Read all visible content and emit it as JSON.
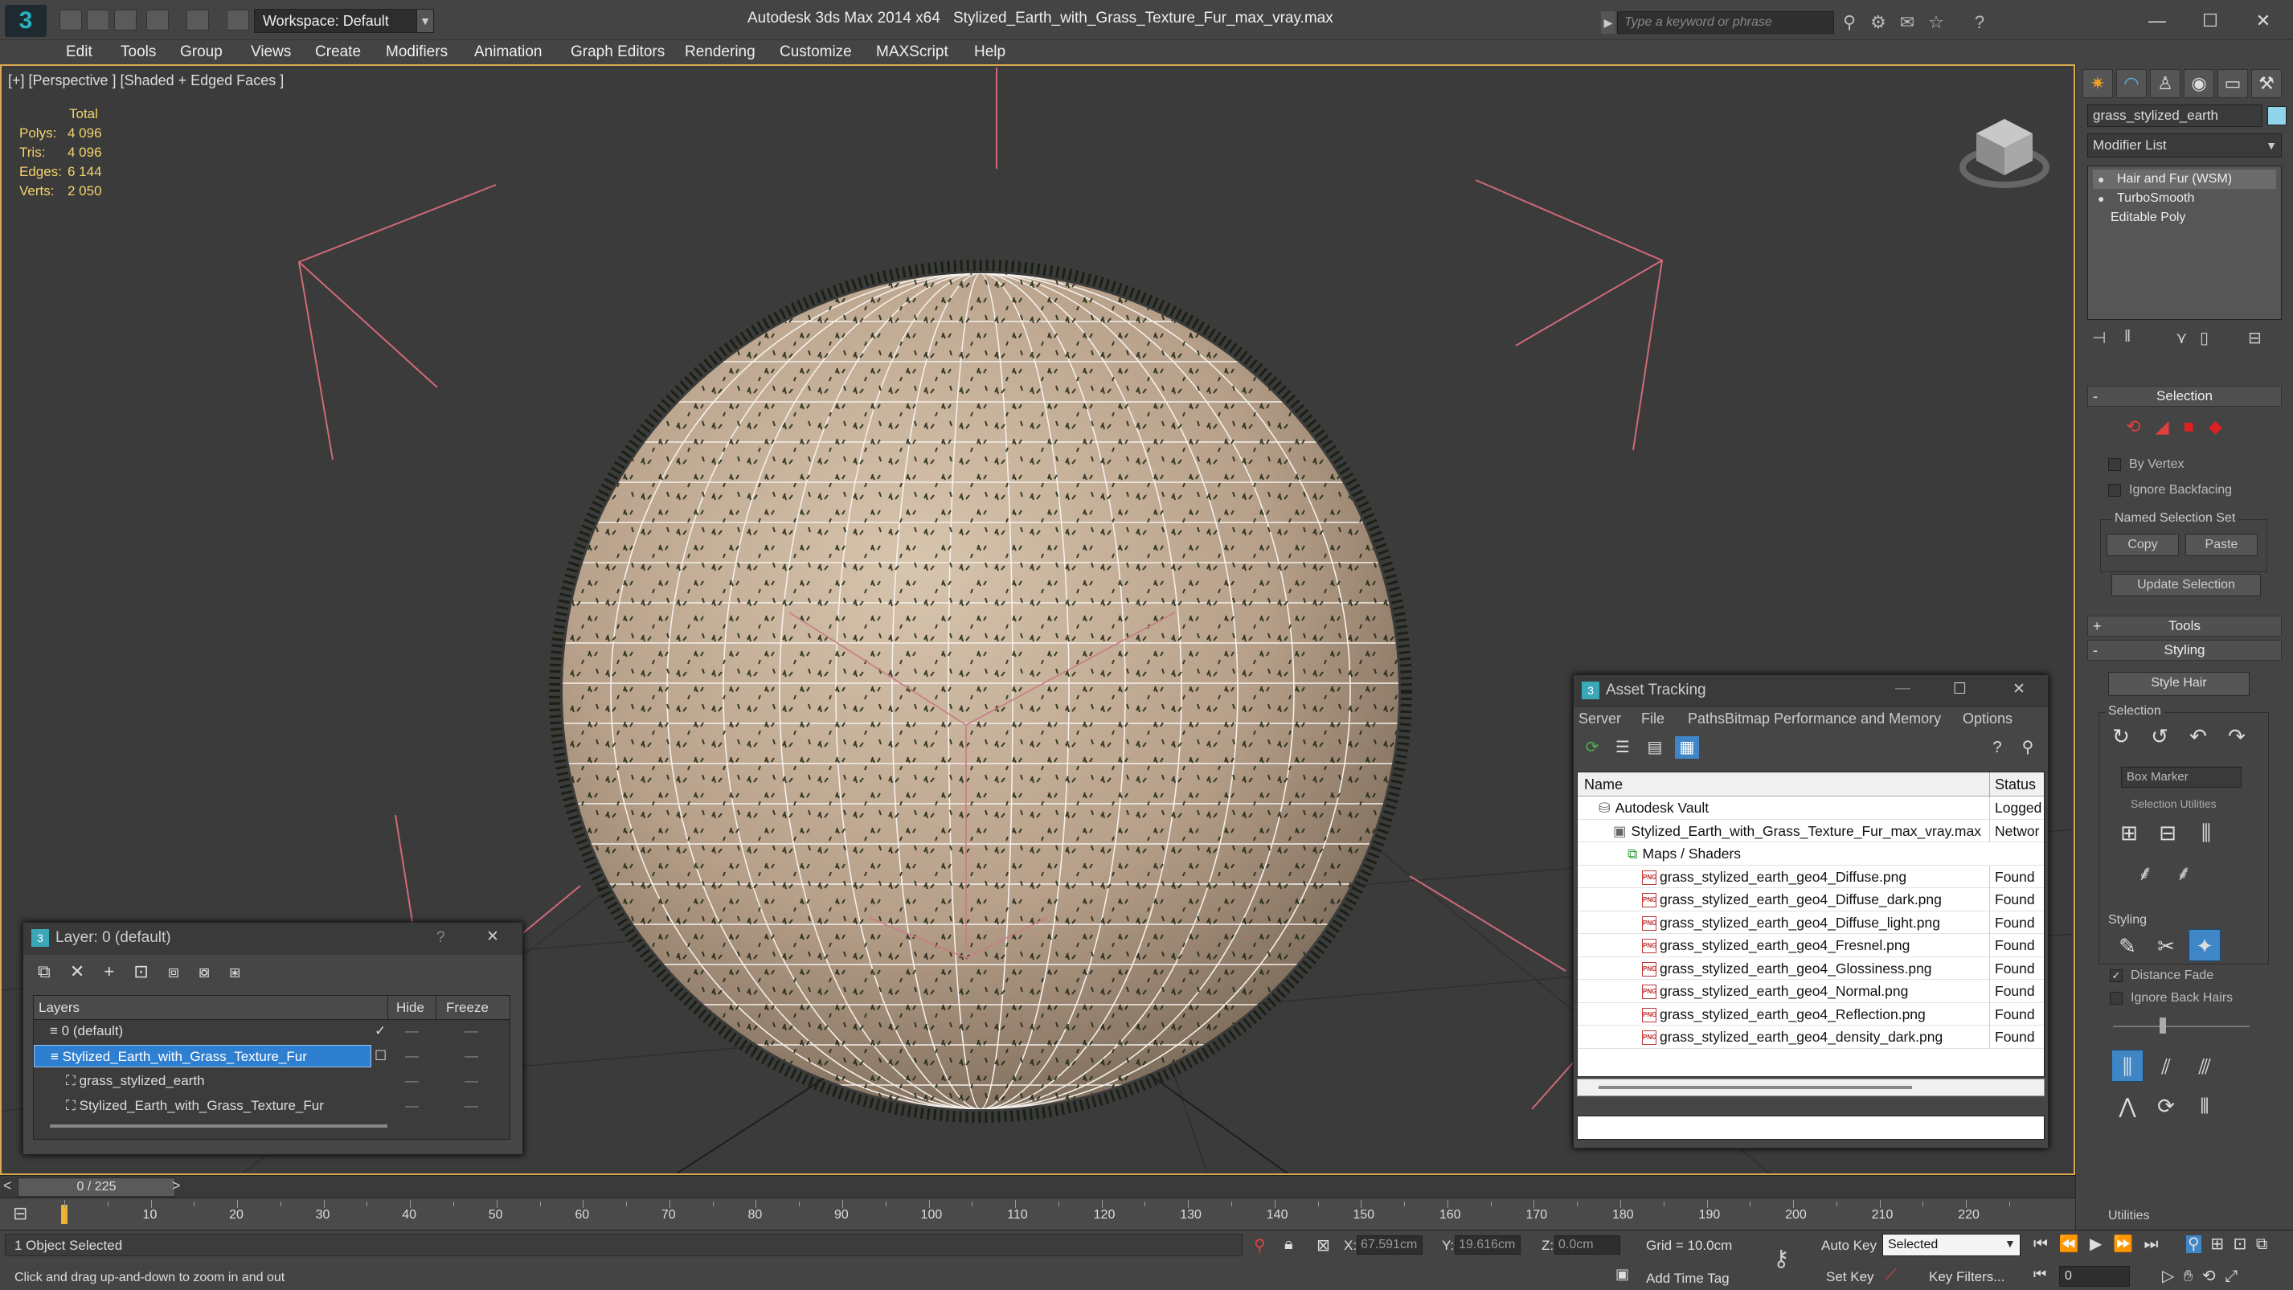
{
  "app": {
    "logo_letter": "3",
    "workspace": "Workspace: Default",
    "title": "Autodesk 3ds Max  2014 x64",
    "file": "Stylized_Earth_with_Grass_Texture_Fur_max_vray.max",
    "search_placeholder": "Type a keyword or phrase"
  },
  "menu": [
    "Edit",
    "Tools",
    "Group",
    "Views",
    "Create",
    "Modifiers",
    "Animation",
    "Graph Editors",
    "Rendering",
    "Customize",
    "MAXScript",
    "Help"
  ],
  "viewport": {
    "label": "[+] [Perspective ] [Shaded + Edged Faces ]",
    "stats_header": "Total",
    "stats": [
      {
        "label": "Polys:",
        "value": "4 096"
      },
      {
        "label": "Tris:",
        "value": "4 096"
      },
      {
        "label": "Edges:",
        "value": "6 144"
      },
      {
        "label": "Verts:",
        "value": "2 050"
      }
    ]
  },
  "command_panel": {
    "object_name": "grass_stylized_earth",
    "object_color": "#8fd4e8",
    "modifier_list": "Modifier List",
    "stack": [
      "Hair and Fur (WSM)",
      "TurboSmooth",
      "Editable Poly"
    ],
    "selection_title": "Selection",
    "by_vertex": "By Vertex",
    "ignore_backfacing": "Ignore Backfacing",
    "named_selection_set": "Named Selection Set",
    "copy": "Copy",
    "paste": "Paste",
    "update_selection": "Update Selection",
    "tools_title": "Tools",
    "styling_title": "Styling",
    "style_hair": "Style Hair",
    "sub_selection": "Selection",
    "box_marker": "Box Marker",
    "selection_utilities": "Selection Utilities",
    "sub_styling": "Styling",
    "distance_fade": "Distance Fade",
    "ignore_back_hairs": "Ignore Back Hairs",
    "utilities": "Utilities"
  },
  "asset_tracking": {
    "title": "Asset Tracking",
    "menu": [
      "Server",
      "File",
      "Paths",
      "Bitmap Performance and Memory",
      "Options"
    ],
    "col_name": "Name",
    "col_status": "Status",
    "rows": [
      {
        "name": "Autodesk Vault",
        "status": "Logged",
        "indent": 1,
        "kind": "vault"
      },
      {
        "name": "Stylized_Earth_with_Grass_Texture_Fur_max_vray.max",
        "status": "Networ",
        "indent": 2,
        "kind": "max"
      },
      {
        "name": "Maps / Shaders",
        "status": "",
        "indent": 3,
        "kind": "folder"
      },
      {
        "name": "grass_stylized_earth_geo4_Diffuse.png",
        "status": "Found",
        "indent": 4,
        "kind": "png"
      },
      {
        "name": "grass_stylized_earth_geo4_Diffuse_dark.png",
        "status": "Found",
        "indent": 4,
        "kind": "png"
      },
      {
        "name": "grass_stylized_earth_geo4_Diffuse_light.png",
        "status": "Found",
        "indent": 4,
        "kind": "png"
      },
      {
        "name": "grass_stylized_earth_geo4_Fresnel.png",
        "status": "Found",
        "indent": 4,
        "kind": "png"
      },
      {
        "name": "grass_stylized_earth_geo4_Glossiness.png",
        "status": "Found",
        "indent": 4,
        "kind": "png"
      },
      {
        "name": "grass_stylized_earth_geo4_Normal.png",
        "status": "Found",
        "indent": 4,
        "kind": "png"
      },
      {
        "name": "grass_stylized_earth_geo4_Reflection.png",
        "status": "Found",
        "indent": 4,
        "kind": "png"
      },
      {
        "name": "grass_stylized_earth_geo4_density_dark.png",
        "status": "Found",
        "indent": 4,
        "kind": "png"
      }
    ],
    "file_icon_text": "PNG"
  },
  "layer_dialog": {
    "title": "Layer: 0 (default)",
    "help": "?",
    "col_layers": "Layers",
    "col_hide": "Hide",
    "col_freeze": "Freeze",
    "rows": [
      {
        "name": "0 (default)",
        "indent": 1,
        "selected": false,
        "check": "✓"
      },
      {
        "name": "Stylized_Earth_with_Grass_Texture_Fur",
        "indent": 1,
        "selected": true,
        "check": "☐"
      },
      {
        "name": "grass_stylized_earth",
        "indent": 2,
        "selected": false,
        "check": ""
      },
      {
        "name": "Stylized_Earth_with_Grass_Texture_Fur",
        "indent": 2,
        "selected": false,
        "check": ""
      }
    ]
  },
  "timeline": {
    "frame": "0 / 225",
    "ticks": [
      "10",
      "20",
      "30",
      "40",
      "50",
      "60",
      "70",
      "80",
      "90",
      "100",
      "110",
      "120",
      "130",
      "140",
      "150",
      "160",
      "170",
      "180",
      "190",
      "200",
      "210",
      "220"
    ]
  },
  "status": {
    "selected": "1 Object Selected",
    "hint": "Click and drag up-and-down to zoom in and out",
    "x_label": "X:",
    "x": "67.591cm",
    "y_label": "Y:",
    "y": "19.616cm",
    "z_label": "Z:",
    "z": "0.0cm",
    "grid": "Grid = 10.0cm",
    "add_time_tag": "Add Time Tag",
    "auto_key": "Auto Key",
    "set_key": "Set Key",
    "key_mode": "Selected",
    "key_filters": "Key Filters...",
    "frame_field": "0"
  }
}
